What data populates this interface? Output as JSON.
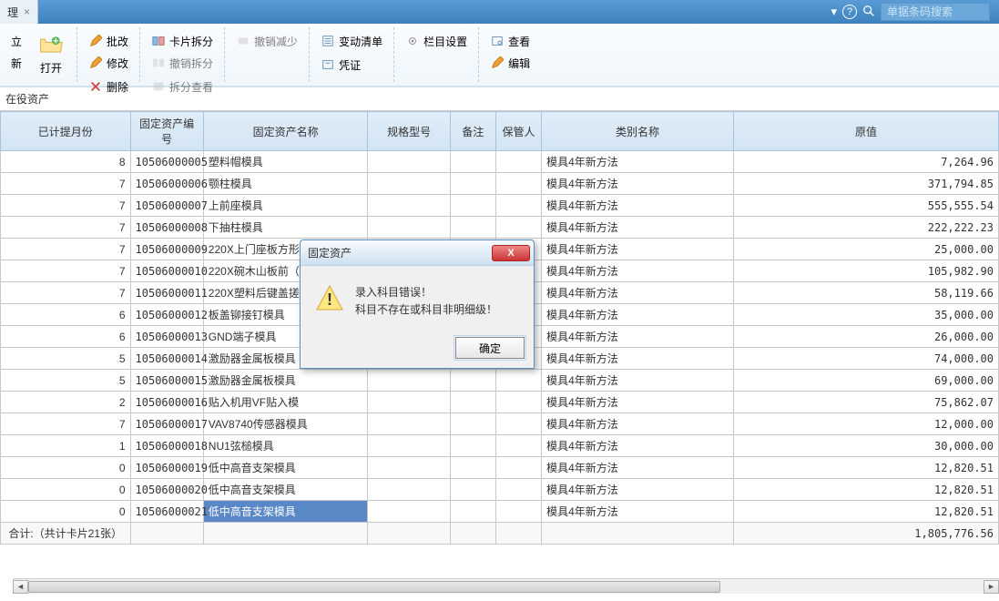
{
  "tab": {
    "label": "理",
    "close": "×"
  },
  "topbar": {
    "dropdown": "▾",
    "help": "?",
    "search_placeholder": "单据条码搜索"
  },
  "ribbon": {
    "group1": {
      "btn1": "立",
      "btn2": "新",
      "open": "打开"
    },
    "group2": {
      "batch": "批改",
      "delete": "删除",
      "modify": "修改"
    },
    "group3": {
      "split": "卡片拆分",
      "split_view": "拆分查看",
      "undo_split": "撤销拆分"
    },
    "group4": {
      "undo_reduce": "撤销减少"
    },
    "group5": {
      "change_list": "变动清单",
      "voucher": "凭证"
    },
    "group6": {
      "column": "栏目设置"
    },
    "group7": {
      "view": "查看",
      "edit": "编辑"
    }
  },
  "section": {
    "title": "在役资产"
  },
  "columns": {
    "month": "已计提月份",
    "code": "固定资产编号",
    "name": "固定资产名称",
    "spec": "规格型号",
    "remark": "备注",
    "keeper": "保管人",
    "category": "类别名称",
    "value": "原值"
  },
  "rows": [
    {
      "month": "8",
      "code": "10506000005",
      "name": "塑料帽模具",
      "cat": "模具4年新方法",
      "val": "7,264.96"
    },
    {
      "month": "7",
      "code": "10506000006",
      "name": "颚柱模具",
      "cat": "模具4年新方法",
      "val": "371,794.85"
    },
    {
      "month": "7",
      "code": "10506000007",
      "name": "上前座模具",
      "cat": "模具4年新方法",
      "val": "555,555.54"
    },
    {
      "month": "7",
      "code": "10506000008",
      "name": "下抽柱模具",
      "cat": "模具4年新方法",
      "val": "222,222.23"
    },
    {
      "month": "7",
      "code": "10506000009",
      "name": "220X上门座板方形",
      "cat": "模具4年新方法",
      "val": "25,000.00"
    },
    {
      "month": "7",
      "code": "10506000010",
      "name": "220X碗木山板前（",
      "cat": "模具4年新方法",
      "val": "105,982.90"
    },
    {
      "month": "7",
      "code": "10506000011",
      "name": "220X塑料后键盖搓",
      "cat": "模具4年新方法",
      "val": "58,119.66"
    },
    {
      "month": "6",
      "code": "10506000012",
      "name": "板盖铆接钉模具",
      "cat": "模具4年新方法",
      "val": "35,000.00"
    },
    {
      "month": "6",
      "code": "10506000013",
      "name": "GND端子模具",
      "cat": "模具4年新方法",
      "val": "26,000.00"
    },
    {
      "month": "5",
      "code": "10506000014",
      "name": "激励器金属板模具",
      "cat": "模具4年新方法",
      "val": "74,000.00"
    },
    {
      "month": "5",
      "code": "10506000015",
      "name": "激励器金属板模具",
      "cat": "模具4年新方法",
      "val": "69,000.00"
    },
    {
      "month": "2",
      "code": "10506000016",
      "name": "贴入机用VF贴入模",
      "cat": "模具4年新方法",
      "val": "75,862.07"
    },
    {
      "month": "7",
      "code": "10506000017",
      "name": "VAV8740传感器模具",
      "cat": "模具4年新方法",
      "val": "12,000.00"
    },
    {
      "month": "1",
      "code": "10506000018",
      "name": "NU1弦槌模具",
      "cat": "模具4年新方法",
      "val": "30,000.00"
    },
    {
      "month": "0",
      "code": "10506000019",
      "name": "低中高音支架模具",
      "cat": "模具4年新方法",
      "val": "12,820.51"
    },
    {
      "month": "0",
      "code": "10506000020",
      "name": "低中高音支架模具",
      "cat": "模具4年新方法",
      "val": "12,820.51"
    },
    {
      "month": "0",
      "code": "10506000021",
      "name": "低中高音支架模具",
      "cat": "模具4年新方法",
      "val": "12,820.51"
    }
  ],
  "footer": {
    "label": "合计:（共计卡片21张）",
    "total": "1,805,776.56"
  },
  "dialog": {
    "title": "固定资产",
    "msg1": "录入科目错误！",
    "msg2": "科目不存在或科目非明细级！",
    "ok": "确定",
    "close": "X"
  }
}
